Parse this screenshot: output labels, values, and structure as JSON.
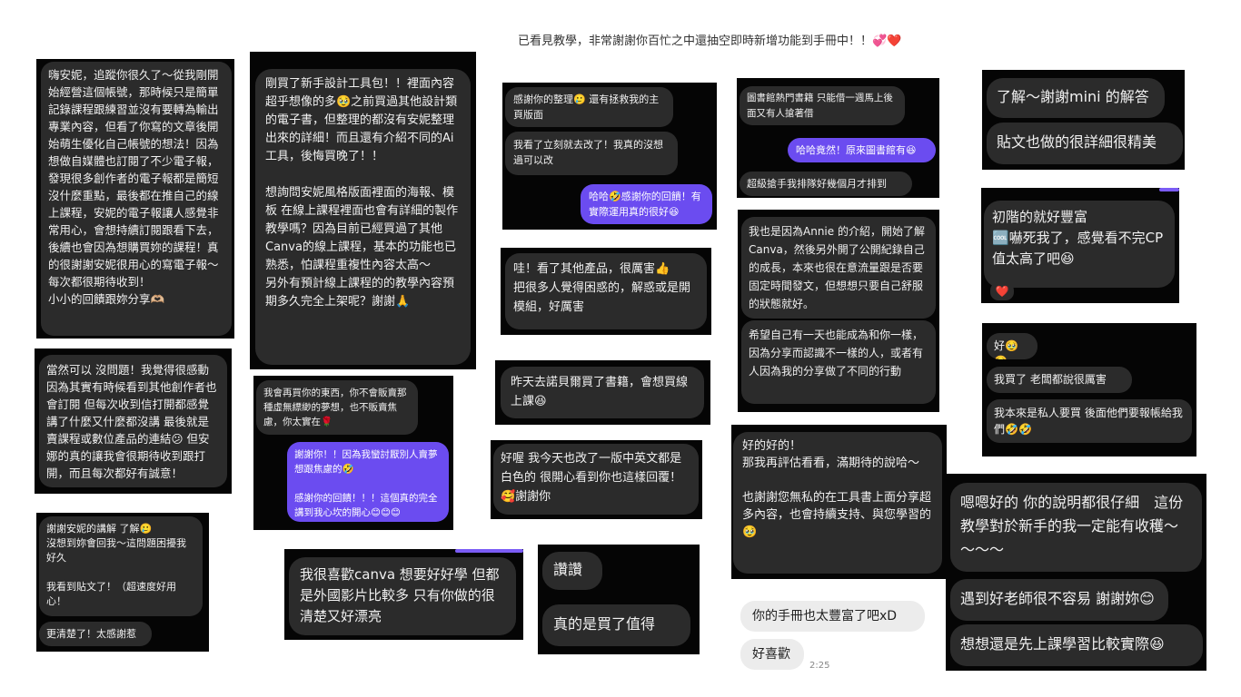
{
  "caption": "已看見教學，非常謝謝你百忙之中還抽空即時新增功能到手冊中！！💞❤️",
  "cards": {
    "a": {
      "b1": "嗨安妮，追蹤你很久了～從我剛開始經營這個帳號，那時候只是簡單記錄課程跟練習並沒有要轉為輸出專業內容，但看了你寫的文章後開始萌生優化自己帳號的想法！因為想做自媒體也訂閱了不少電子報，發現很多創作者的電子報都是簡短沒什麼重點，最後都在推自己的線上課程，安妮的電子報讓人感覺非常用心，會想持續訂閱跟看下去，後續也會因為想購買妳的課程！真的很謝謝安妮很用心的寫電子報～每次都很期待收到！\n小小的回饋跟妳分享🫶🏼"
    },
    "b": {
      "b1": "當然可以 沒問題！我覺得很感動因為其實有時候看到其他創作者也會訂閱 但每次收到信打開都感覺講了什麼又什麼都沒講 最後就是賣課程或數位產品的連結😕 但安娜的真的讓我會很期待收到跟打開，而且每次都好有誠意！"
    },
    "c": {
      "b1": "謝謝安妮的講解 了解🥲\n沒想到妳會回我～這問題困擾我好久\n\n我看到貼文了！（超速度好用心！",
      "b2": "更清楚了！太感謝惹"
    },
    "d": {
      "b1": "剛買了新手設計工具包！！裡面內容超乎想像的多🥹之前買過其他設計類的電子書，但整理的都沒有安妮整理出來的詳細！而且還有介紹不同的Ai工具，後悔買晚了！！\n\n想詢問安妮風格版面裡面的海報、模板 在線上課程裡面也會有詳細的製作教學嗎？因為目前已經買過了其他Canva的線上課程，基本的功能也已熟悉，怕課程重複性內容太高～\n另外有預計線上課程的的教學內容預期多久完全上架呢？謝謝🙏"
    },
    "e": {
      "b1": "我會再買你的東西，你不會販賣那種虛無縹緲的夢想，也不販賣焦慮，你太實在🌹",
      "b2": "謝謝你！！因為我蠻討厭別人賣夢想跟焦慮的🤣\n\n感謝你的回饋！！！這個真的完全講到我心坎的開心😊😊😊"
    },
    "f": {
      "b1": "我很喜歡canva 想要好好學 但都是外國影片比較多 只有你做的很清楚又好漂亮"
    },
    "g": {
      "b1": "感謝你的整理🥲 還有拯救我的主頁版面",
      "b2": "我看了立刻就去改了！我真的沒想過可以改",
      "b3": "哈哈🤣感謝你的回饋！有實際運用真的很好😆"
    },
    "h": {
      "b1": "哇！看了其他產品，很厲害👍\n把很多人覺得困惑的，解惑或是開模組，好厲害"
    },
    "i": {
      "b1": "昨天去諾貝爾買了書籍，會想買線上課😆"
    },
    "j": {
      "b1": "好喔 我今天也改了一版中英文都是白色的 很開心看到你也這樣回覆！🥰謝謝你"
    },
    "k": {
      "b1": "讚讚",
      "b2": "真的是買了值得"
    },
    "l": {
      "b1": "圖書館熱門書籍 只能借一週馬上後面又有人搶著借",
      "b2": "哈哈竟然！原來圖書館有😆",
      "b3": "超級搶手我排隊好幾個月才排到"
    },
    "m": {
      "b1": "我也是因為Annie 的介紹，開始了解Canva，然後另外開了公開紀錄自己的成長，本來也很在意流量跟是否要固定時間發文，但想想只要自己舒服的狀態就好。",
      "b2": "希望自己有一天也能成為和你一樣，因為分享而認識不一樣的人，或者有人因為我的分享做了不同的行動"
    },
    "n": {
      "b1": "好的好的！\n那我再評估看看，滿期待的說哈～\n\n也謝謝您無私的在工具書上面分享超多內容，也會持續支持、與您學習的🥹"
    },
    "o": {
      "b1": "你的手冊也太豐富了吧xD",
      "b2": "好喜歡",
      "time": "2:25"
    },
    "p": {
      "b1": "了解～謝謝mini 的解答",
      "b2": "貼文也做的很詳細很精美"
    },
    "q": {
      "b1": "初階的就好豐富\n🆒嚇死我了，感覺看不完CP值太高了吧😆",
      "react": "❤️"
    },
    "r": {
      "b1": "好🥹🥹",
      "b2": "我買了 老闆都說很厲害",
      "b3": "我本來是私人要買 後面他們要報帳給我們🤣🤣"
    },
    "s": {
      "b1": "嗯嗯好的 你的說明都很仔細　這份教學對於新手的我一定能有收穫～～～～",
      "b2": "遇到好老師很不容易 謝謝妳😊",
      "b3": "想想還是先上課學習比較實際😆"
    }
  }
}
